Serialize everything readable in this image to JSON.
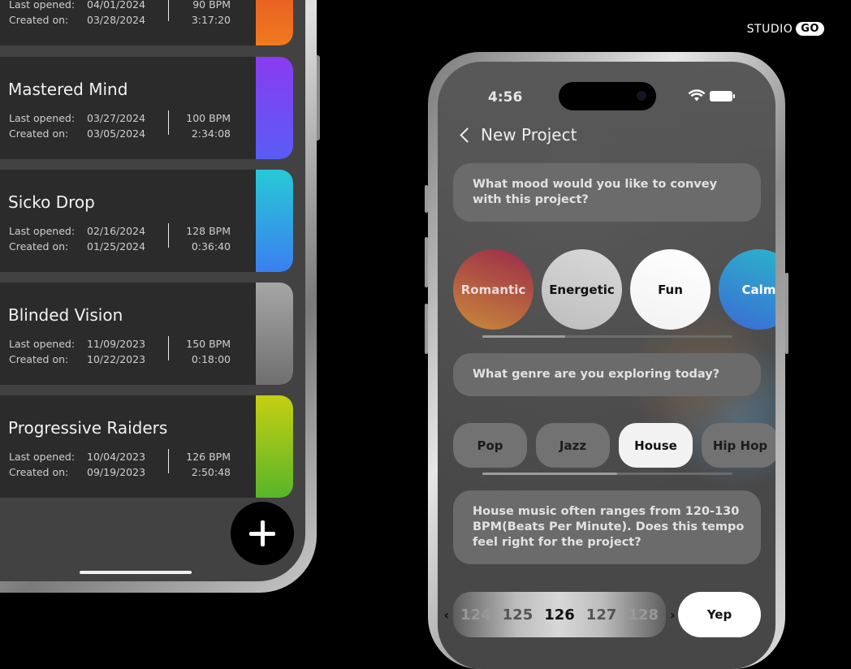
{
  "brand": {
    "name": "STUDIO",
    "badge": "GO"
  },
  "projects": [
    {
      "title": "",
      "last_opened_label": "Last opened:",
      "last_opened": "04/01/2024",
      "created_label": "Created on:",
      "created": "03/28/2024",
      "bpm": "90 BPM",
      "duration": "3:17:20",
      "gradient": [
        "#e0442b",
        "#f07a1e"
      ]
    },
    {
      "title": "Mastered Mind",
      "last_opened_label": "Last opened:",
      "last_opened": "03/27/2024",
      "created_label": "Created on:",
      "created": "03/05/2024",
      "bpm": "100 BPM",
      "duration": "2:34:08",
      "gradient": [
        "#8a3cf0",
        "#5a5cf5"
      ]
    },
    {
      "title": "Sicko Drop",
      "last_opened_label": "Last opened:",
      "last_opened": "02/16/2024",
      "created_label": "Created on:",
      "created": "01/25/2024",
      "bpm": "128 BPM",
      "duration": "0:36:40",
      "gradient": [
        "#27c9d6",
        "#3b7ff0"
      ]
    },
    {
      "title": "Blinded Vision",
      "last_opened_label": "Last opened:",
      "last_opened": "11/09/2023",
      "created_label": "Created on:",
      "created": "10/22/2023",
      "bpm": "150 BPM",
      "duration": "0:18:00",
      "gradient": [
        "#a6a6a6",
        "#6f6f6f"
      ]
    },
    {
      "title": "Progressive Raiders",
      "last_opened_label": "Last opened:",
      "last_opened": "10/04/2023",
      "created_label": "Created on:",
      "created": "09/19/2023",
      "bpm": "126 BPM",
      "duration": "2:50:48",
      "gradient": [
        "#c6cf12",
        "#58b52a"
      ]
    }
  ],
  "add_button_icon": "plus-icon",
  "phone": {
    "time": "4:56",
    "nav_title": "New Project",
    "mood_question": "What mood would you like to convey with this project?",
    "moods": [
      {
        "label": "Romantic",
        "colors": [
          "#9b2a4a",
          "#c98a3a"
        ],
        "text": "#ecd9d9"
      },
      {
        "label": "Energetic",
        "colors": [
          "#d9d9d9",
          "#bdbdbd"
        ],
        "text": "#111111"
      },
      {
        "label": "Fun",
        "colors": [
          "#ffffff",
          "#f2f2f2"
        ],
        "text": "#111111"
      },
      {
        "label": "Calm",
        "colors": [
          "#2bb6c9",
          "#3b6bd6"
        ],
        "text": "#ffffff"
      }
    ],
    "mood_scroll_fraction": 0.33,
    "genre_question": "What genre are you exploring today?",
    "genres": [
      {
        "label": "Pop",
        "selected": false
      },
      {
        "label": "Jazz",
        "selected": false
      },
      {
        "label": "House",
        "selected": true
      },
      {
        "label": "Hip Hop",
        "selected": false
      }
    ],
    "genre_scroll_fraction": 0.54,
    "tempo_message": "House music often ranges from 120-130 BPM(Beats Per Minute). Does this tempo feel right for the project?",
    "tempo_values": [
      "124",
      "125",
      "126",
      "127",
      "128"
    ],
    "tempo_selected": "126",
    "confirm_label": "Yep"
  }
}
